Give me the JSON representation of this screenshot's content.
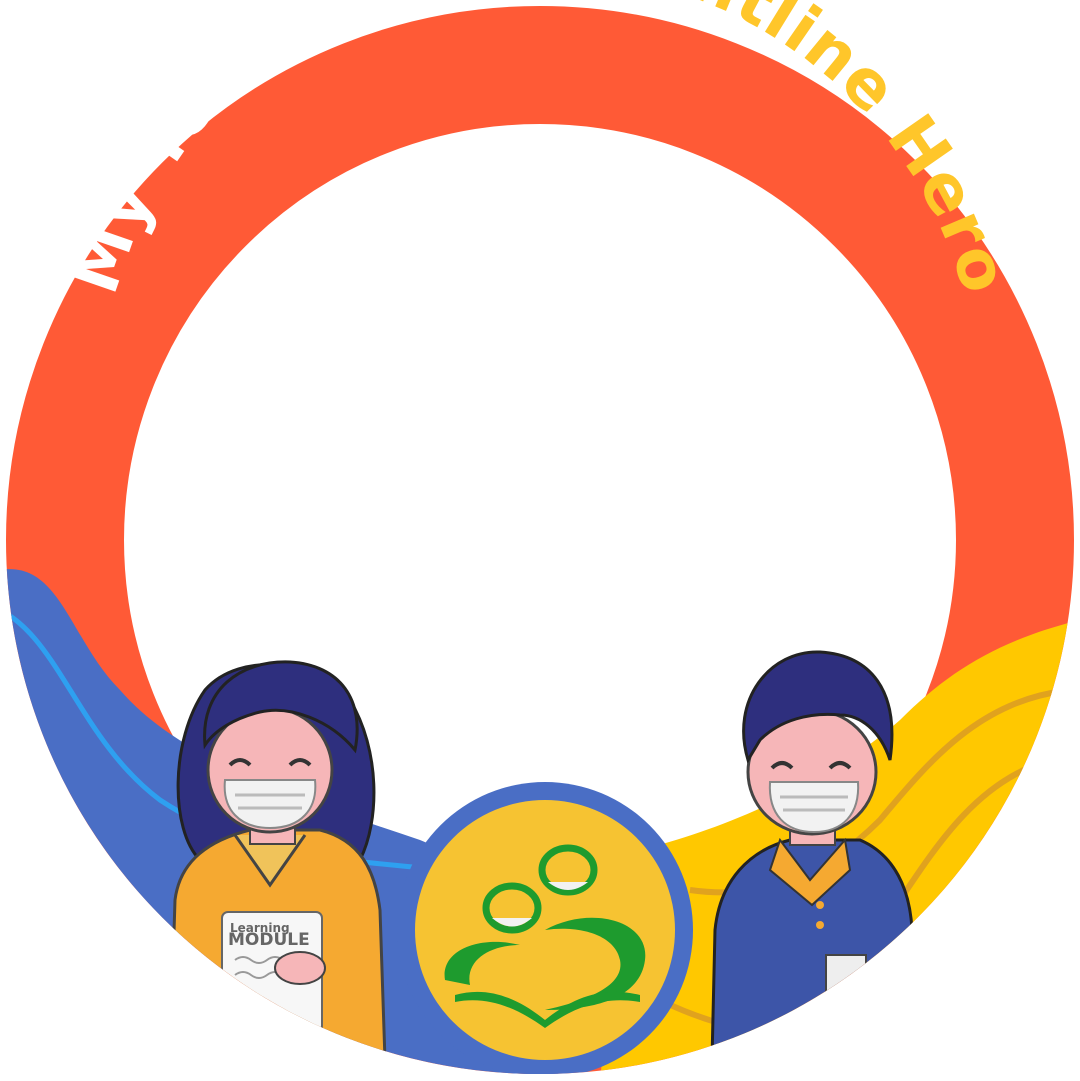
{
  "banner": {
    "text_part1": "My Teacher, ",
    "text_part2": "My Frontline Hero"
  },
  "module": {
    "line1": "Learning",
    "line2": "MODULE"
  },
  "colors": {
    "ring": "#FF5A36",
    "text_white": "#FFFFFF",
    "text_yellow": "#FFC62A",
    "wave_blue": "#4A6EC5",
    "wave_yellow": "#FFC800",
    "emblem_blue": "#4A6EC5",
    "emblem_gold": "#F6C332",
    "emblem_green": "#1E9B2E",
    "hair": "#2E2F7E",
    "skin": "#F6B6B8",
    "shirt_orange": "#F5A931",
    "shirt_blue": "#3D55A8"
  },
  "icons": [
    "teacher-girl-icon",
    "student-boy-icon",
    "school-emblem-icon"
  ]
}
